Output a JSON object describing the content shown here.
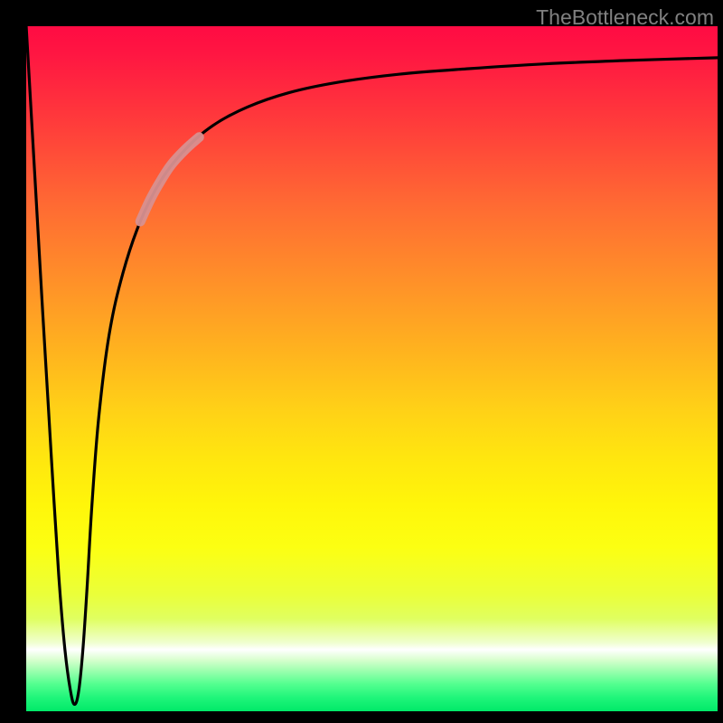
{
  "watermark": "TheBottleneck.com",
  "chart_data": {
    "type": "line",
    "title": "",
    "xlabel": "",
    "ylabel": "",
    "xlim": [
      0,
      100
    ],
    "ylim": [
      0,
      100
    ],
    "grid": false,
    "legend": false,
    "annotations": [],
    "series": [
      {
        "name": "bottleneck-curve",
        "color": "#000000",
        "x": [
          0.0,
          0.8,
          1.6,
          2.4,
          3.2,
          4.0,
          4.8,
          5.6,
          6.4,
          7.0,
          7.6,
          8.2,
          8.8,
          9.5,
          10.5,
          12.0,
          14.0,
          16.5,
          19.5,
          23.0,
          27.0,
          32.0,
          38.0,
          45.0,
          54.0,
          64.0,
          75.0,
          87.0,
          100.0
        ],
        "y": [
          100.0,
          86.0,
          72.0,
          58.0,
          44.5,
          31.0,
          18.5,
          9.0,
          3.0,
          1.0,
          3.0,
          9.0,
          18.0,
          30.0,
          43.0,
          55.0,
          64.0,
          71.5,
          77.5,
          82.0,
          85.5,
          88.2,
          90.3,
          91.8,
          93.0,
          93.8,
          94.5,
          95.0,
          95.4
        ]
      },
      {
        "name": "highlight-segment",
        "color": "#d89090",
        "x": [
          16.5,
          18.0,
          19.5,
          21.0,
          23.0,
          25.0
        ],
        "y": [
          71.5,
          74.8,
          77.5,
          79.8,
          82.0,
          83.8
        ]
      }
    ]
  }
}
